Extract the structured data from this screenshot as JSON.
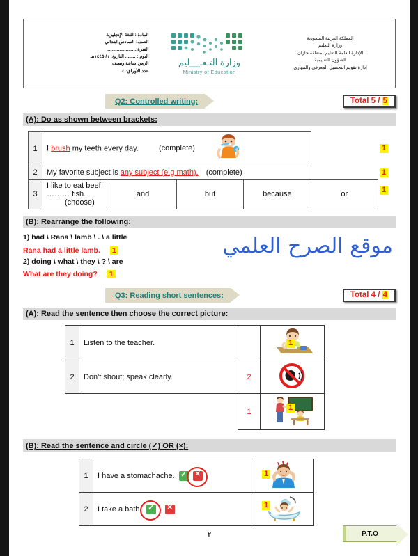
{
  "header": {
    "left_lines": [
      "المادة : اللغة الإنجليزية",
      "الصف: السادس ابتدائي",
      "الفترة:.......................",
      "اليوم : ........ التاريخ:   /   / ١٤٤٥هـ",
      "الزمن:ساعة ونصف",
      "عدد الأوراق: ٤"
    ],
    "logo": {
      "arabic": "وزارة التـعـ__ليم",
      "english": "Ministry of Education",
      "dot_color": "#3a9e94"
    },
    "right_lines": [
      "المملكة العربية السعودية",
      "وزارة التعليم",
      "الإدارة العامة للتعليم بمنطقة جازان",
      "الشؤون التعليمية",
      "إدارة  تقويم التحصيل المعرفي والمهاري"
    ]
  },
  "colors": {
    "banner_bg": "#dedac6",
    "banner_text": "#1a7f7a",
    "mark_highlight": "#fff200",
    "red": "#e8201c",
    "section_bg": "#d9d9d9"
  },
  "q2": {
    "banner": "Q2: Controlled writing:",
    "total_prefix": "Total 5 / ",
    "total_highlight": "5",
    "section_a": {
      "label": "(A): Do as shown between brackets:",
      "rows": [
        {
          "num": "1",
          "text_before": "I ",
          "answer": "brush",
          "text_after": " my teeth every day.",
          "instruction": "(complete)",
          "picture": "boy-brushing-teeth",
          "mark": "1"
        },
        {
          "num": "2",
          "text_before": "My favorite subject is ",
          "answer": "any subject (e.g math).",
          "text_after": "",
          "instruction": "(complete)",
          "picture": "",
          "mark": "1"
        },
        {
          "num": "3",
          "text_before": "I like to eat beef ……… fish.",
          "answer": "",
          "text_after": "",
          "instruction": "(choose)",
          "options": [
            "and",
            "but",
            "because",
            "or"
          ],
          "selected_option": "and",
          "mark": "1"
        }
      ]
    },
    "section_b": {
      "label": "(B): Rearrange the following:",
      "items": [
        {
          "prompt": "1) had \\ Rana \\ lamb \\ . \\ a little",
          "answer": "Rana had a little lamb.",
          "mark": "1"
        },
        {
          "prompt": "2) doing \\ what \\ they \\ ? \\ are",
          "answer": "What are they doing?",
          "mark": "1"
        }
      ],
      "watermark": "موقع الصرح العلمي"
    }
  },
  "q3": {
    "banner": "Q3: Reading short sentences:",
    "total_prefix": "Total 4 / ",
    "total_highlight": "4",
    "section_a": {
      "label": "(A): Read the sentence then choose the correct picture:",
      "rows": [
        {
          "num": "1",
          "sentence": "Listen to the teacher.",
          "choice": "",
          "picture": "child-writing-at-desk",
          "mark": "1"
        },
        {
          "num": "2",
          "sentence": "Don't shout; speak clearly.",
          "choice": "2",
          "picture": "no-shouting-sign",
          "mark": ""
        },
        {
          "num": "",
          "sentence": "",
          "choice": "1",
          "picture": "teacher-at-blackboard",
          "mark": "1"
        }
      ]
    },
    "section_b": {
      "label": "(B): Read the sentence and circle (✓) OR (×):",
      "rows": [
        {
          "num": "1",
          "sentence": "I have a stomachache.",
          "circled": "cross",
          "picture": "man-with-headache",
          "mark": "1"
        },
        {
          "num": "2",
          "sentence": "I take a bath.",
          "circled": "tick",
          "picture": "baby-in-bathtub",
          "mark": "1"
        }
      ]
    }
  },
  "footer": {
    "page_number": "٢",
    "pto": "P.T.O"
  }
}
